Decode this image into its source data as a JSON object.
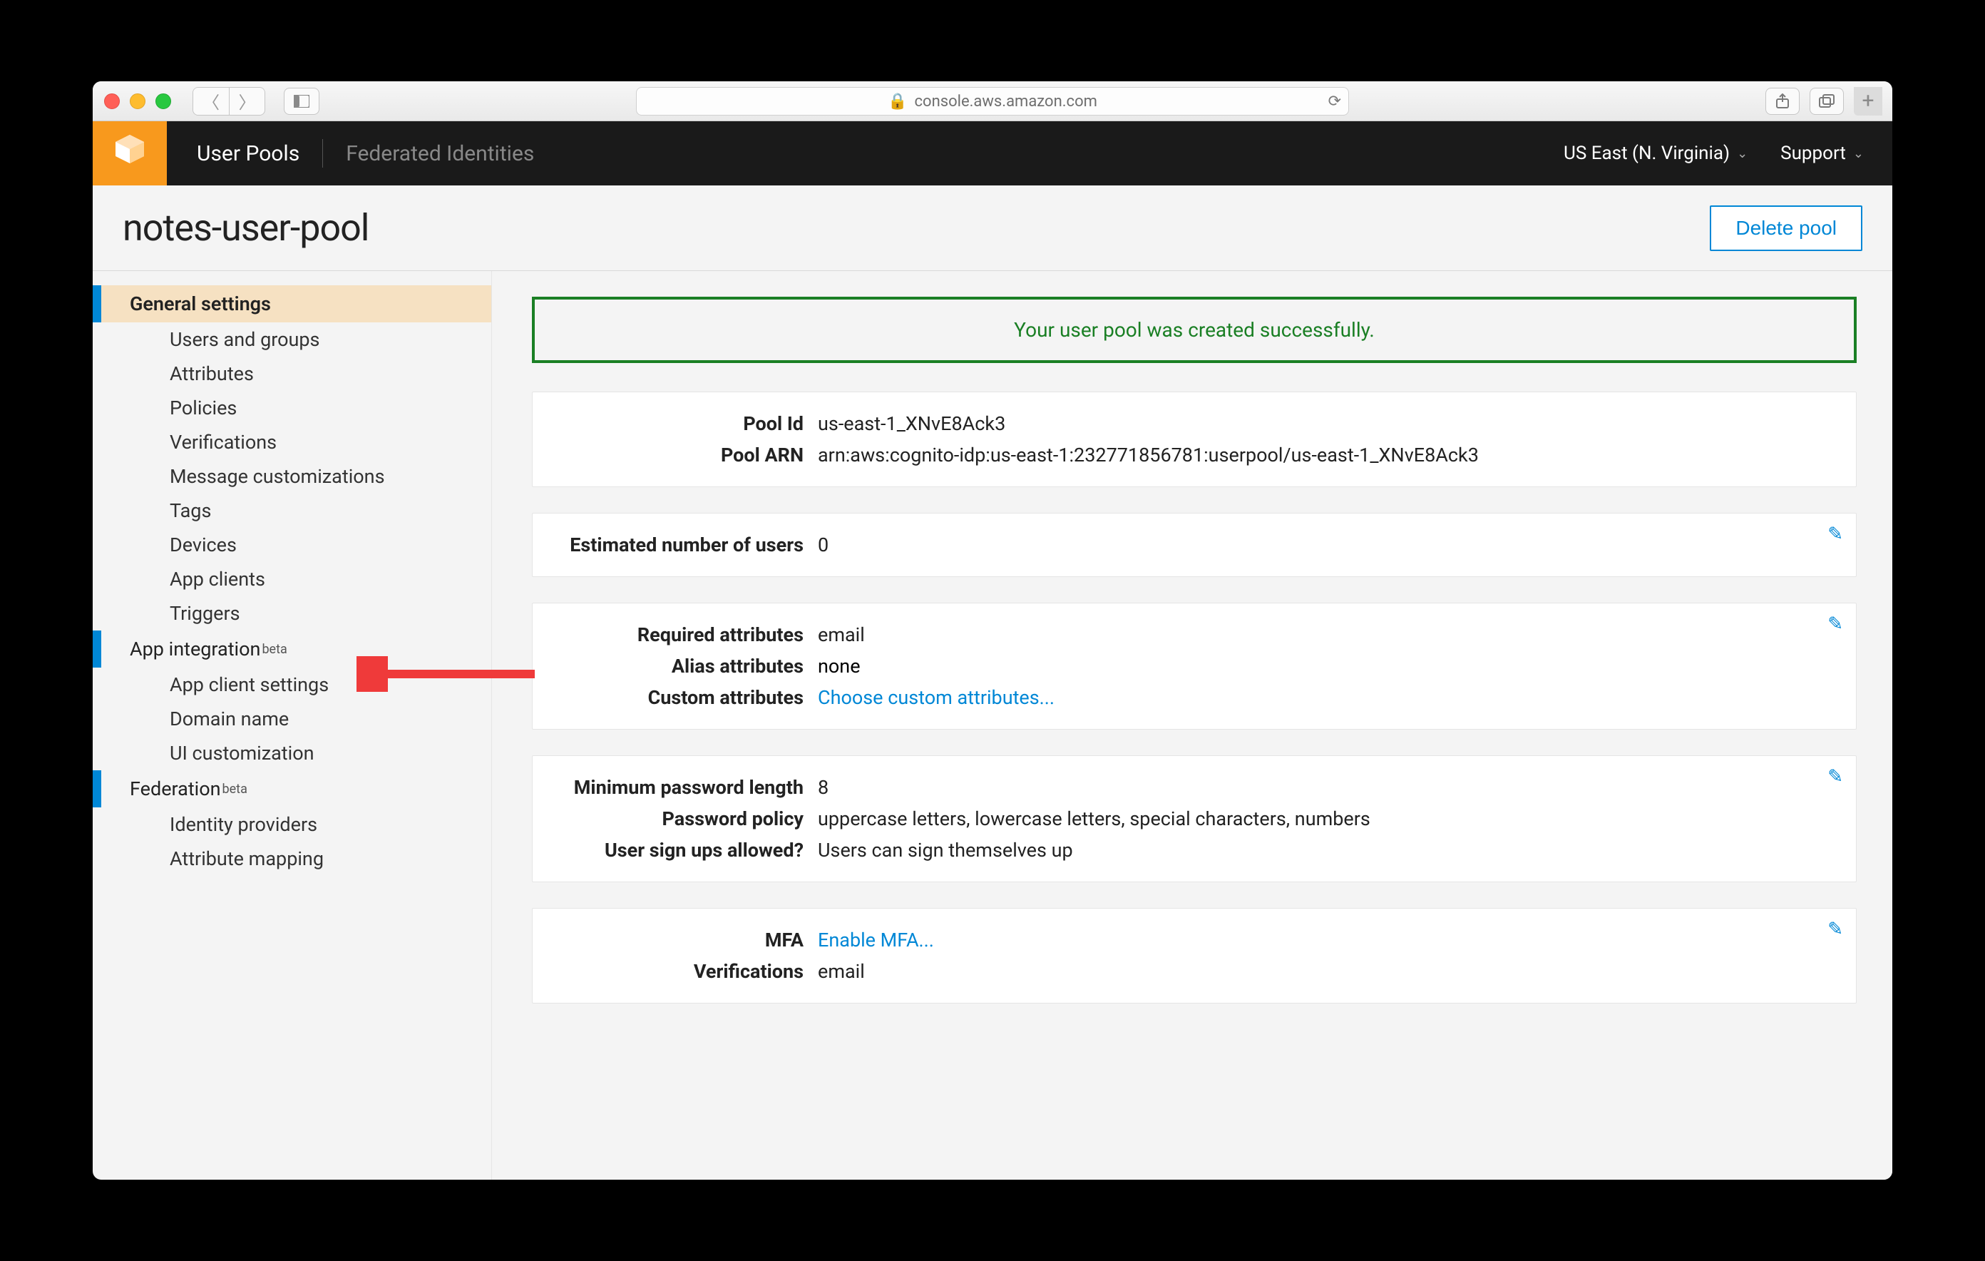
{
  "browser": {
    "url_host": "console.aws.amazon.com"
  },
  "header": {
    "user_pools": "User Pools",
    "federated": "Federated Identities",
    "region": "US East (N. Virginia)",
    "support": "Support"
  },
  "page": {
    "title": "notes-user-pool",
    "delete_button": "Delete pool"
  },
  "sidebar": {
    "general": "General settings",
    "items_general": [
      "Users and groups",
      "Attributes",
      "Policies",
      "Verifications",
      "Message customizations",
      "Tags",
      "Devices",
      "App clients",
      "Triggers"
    ],
    "app_integration": "App integration",
    "items_app": [
      "App client settings",
      "Domain name",
      "UI customization"
    ],
    "federation": "Federation",
    "items_fed": [
      "Identity providers",
      "Attribute mapping"
    ],
    "beta": "beta"
  },
  "banner": {
    "success": "Your user pool was created successfully."
  },
  "cards": {
    "pool": {
      "id_label": "Pool Id",
      "id_value": "us-east-1_XNvE8Ack3",
      "arn_label": "Pool ARN",
      "arn_value": "arn:aws:cognito-idp:us-east-1:232771856781:userpool/us-east-1_XNvE8Ack3"
    },
    "users": {
      "label": "Estimated number of users",
      "value": "0"
    },
    "attributes": {
      "required_label": "Required attributes",
      "required_value": "email",
      "alias_label": "Alias attributes",
      "alias_value": "none",
      "custom_label": "Custom attributes",
      "custom_value": "Choose custom attributes..."
    },
    "password": {
      "minlen_label": "Minimum password length",
      "minlen_value": "8",
      "policy_label": "Password policy",
      "policy_value": "uppercase letters, lowercase letters, special characters, numbers",
      "signup_label": "User sign ups allowed?",
      "signup_value": "Users can sign themselves up"
    },
    "mfa": {
      "mfa_label": "MFA",
      "mfa_value": "Enable MFA...",
      "verif_label": "Verifications",
      "verif_value": "email"
    }
  }
}
